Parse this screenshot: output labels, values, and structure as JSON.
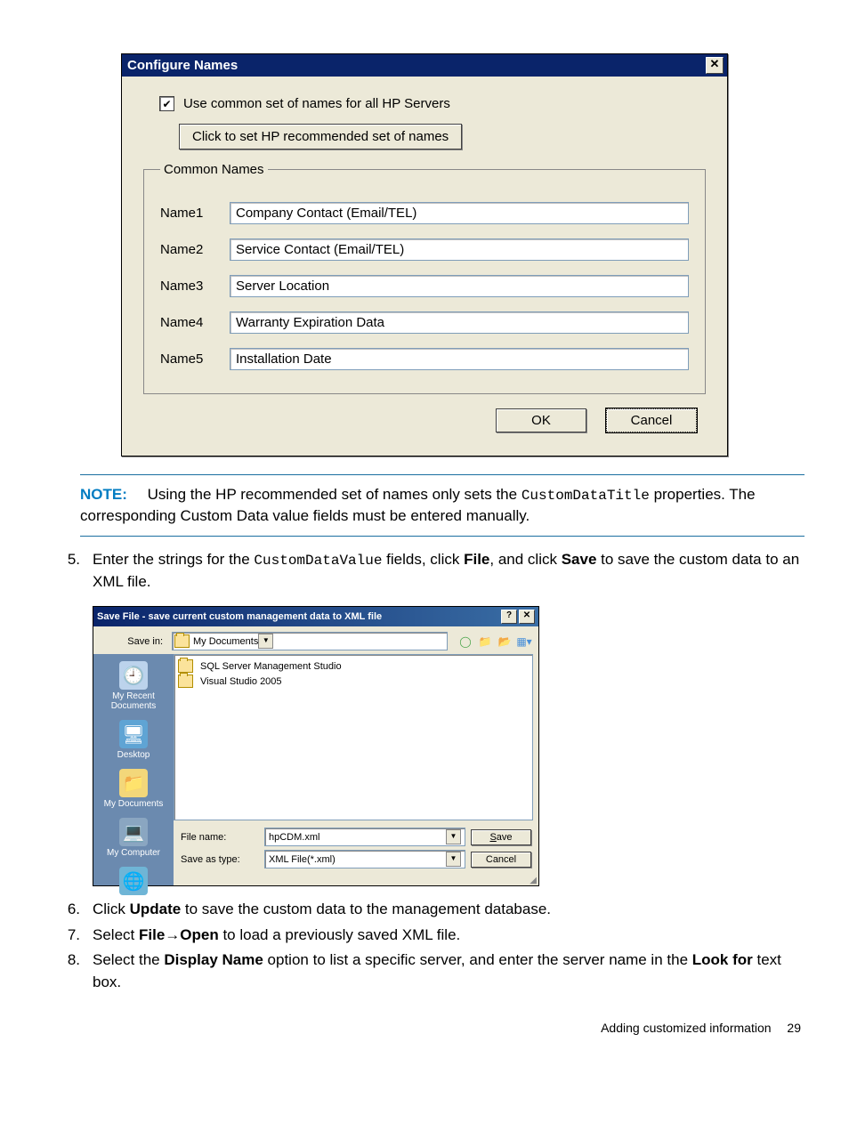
{
  "dialog1": {
    "title": "Configure Names",
    "checkbox_label": "Use common set of names for all HP Servers",
    "recommend_button": "Click to set HP recommended set of names",
    "fieldset_legend": "Common Names",
    "rows": [
      {
        "label": "Name1",
        "value": "Company Contact (Email/TEL)"
      },
      {
        "label": "Name2",
        "value": "Service Contact (Email/TEL)"
      },
      {
        "label": "Name3",
        "value": "Server Location"
      },
      {
        "label": "Name4",
        "value": "Warranty Expiration Data"
      },
      {
        "label": "Name5",
        "value": "Installation Date"
      }
    ],
    "ok": "OK",
    "cancel": "Cancel"
  },
  "note": {
    "label": "NOTE:",
    "text1": "Using the HP recommended set of names only sets the ",
    "code1": "CustomDataTitle",
    "text2": " properties. The corresponding Custom Data value fields must be entered manually."
  },
  "step5": {
    "num": "5.",
    "t1": "Enter the strings for the ",
    "code": "CustomDataValue",
    "t2": " fields, click ",
    "b1": "File",
    "t3": ", and click ",
    "b2": "Save",
    "t4": " to save the custom data to an XML file."
  },
  "dialog2": {
    "title": "Save File - save current custom management data to XML file",
    "save_in_label": "Save in:",
    "save_in_value": "My Documents",
    "sidebar": [
      "My Recent Documents",
      "Desktop",
      "My Documents",
      "My Computer",
      "My Network Places"
    ],
    "files": [
      "SQL Server Management Studio",
      "Visual Studio 2005"
    ],
    "file_name_label": "File name:",
    "file_name_value": "hpCDM.xml",
    "save_as_type_label": "Save as type:",
    "save_as_type_value": "XML File(*.xml)",
    "save": "Save",
    "cancel": "Cancel"
  },
  "step6": {
    "num": "6.",
    "t1": "Click ",
    "b1": "Update",
    "t2": " to save the custom data to the management database."
  },
  "step7": {
    "num": "7.",
    "t1": "Select ",
    "b1": "File",
    "arrow": "→",
    "b2": "Open",
    "t2": " to load a previously saved XML file."
  },
  "step8": {
    "num": "8.",
    "t1": "Select the ",
    "b1": "Display Name",
    "t2": " option to list a specific server, and enter the server name in the ",
    "b2": "Look for",
    "t3": " text box."
  },
  "footer": {
    "section": "Adding customized information",
    "page": "29"
  }
}
